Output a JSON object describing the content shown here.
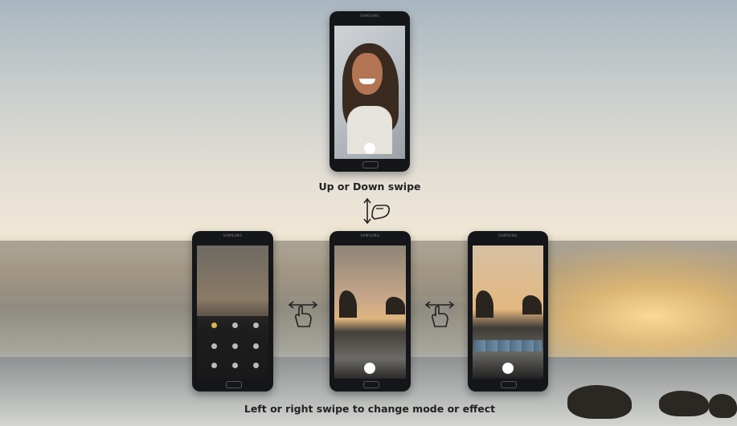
{
  "captions": {
    "top": "Up or Down swipe",
    "bottom": "Left or right swipe to change mode or effect"
  },
  "brand": "SAMSUNG",
  "icons": {
    "vertical_swipe": "vertical-swipe-gesture-icon",
    "horizontal_swipe": "horizontal-swipe-gesture-icon"
  },
  "colors": {
    "phone_body": "#141619",
    "caption_text": "#222222"
  }
}
